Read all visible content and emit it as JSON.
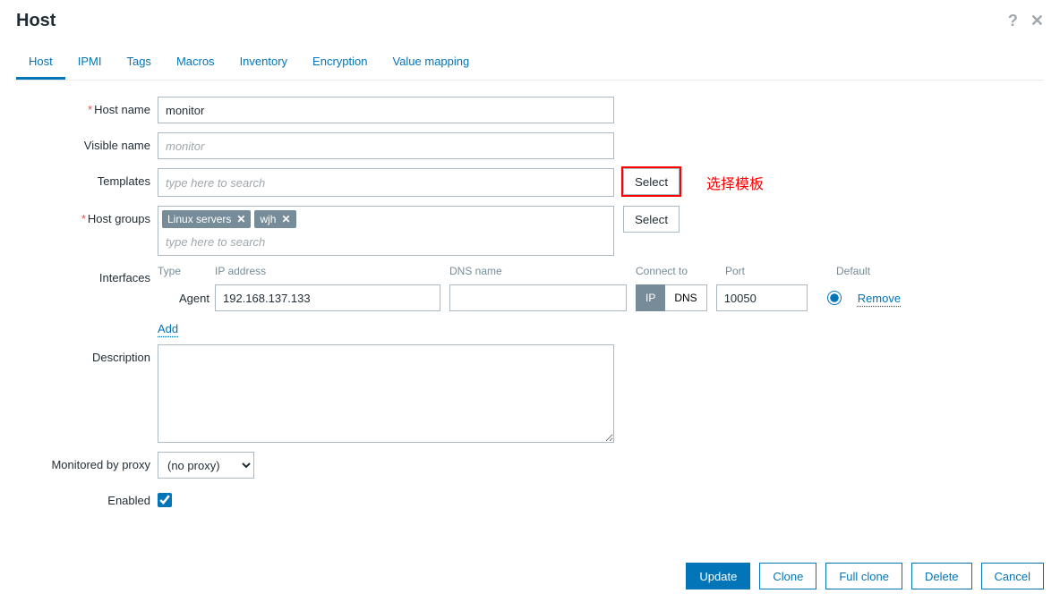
{
  "header": {
    "title": "Host"
  },
  "tabs": [
    "Host",
    "IPMI",
    "Tags",
    "Macros",
    "Inventory",
    "Encryption",
    "Value mapping"
  ],
  "labels": {
    "host_name": "Host name",
    "visible_name": "Visible name",
    "templates": "Templates",
    "host_groups": "Host groups",
    "interfaces": "Interfaces",
    "description": "Description",
    "monitored_by_proxy": "Monitored by proxy",
    "enabled": "Enabled"
  },
  "fields": {
    "host_name": "monitor",
    "visible_name_placeholder": "monitor",
    "templates_placeholder": "type here to search",
    "host_groups_placeholder": "type here to search",
    "select_btn": "Select",
    "annotation": "选择模板",
    "no_proxy": "(no proxy)"
  },
  "host_groups": [
    {
      "label": "Linux servers"
    },
    {
      "label": "wjh"
    }
  ],
  "interfaces": {
    "head": {
      "type": "Type",
      "ip": "IP address",
      "dns": "DNS name",
      "connect": "Connect to",
      "port": "Port",
      "default": "Default"
    },
    "rows": [
      {
        "type": "Agent",
        "ip": "192.168.137.133",
        "dns": "",
        "connect_ip": "IP",
        "connect_dns": "DNS",
        "port": "10050",
        "remove": "Remove"
      }
    ],
    "add": "Add"
  },
  "footer": {
    "update": "Update",
    "clone": "Clone",
    "full_clone": "Full clone",
    "delete": "Delete",
    "cancel": "Cancel"
  }
}
